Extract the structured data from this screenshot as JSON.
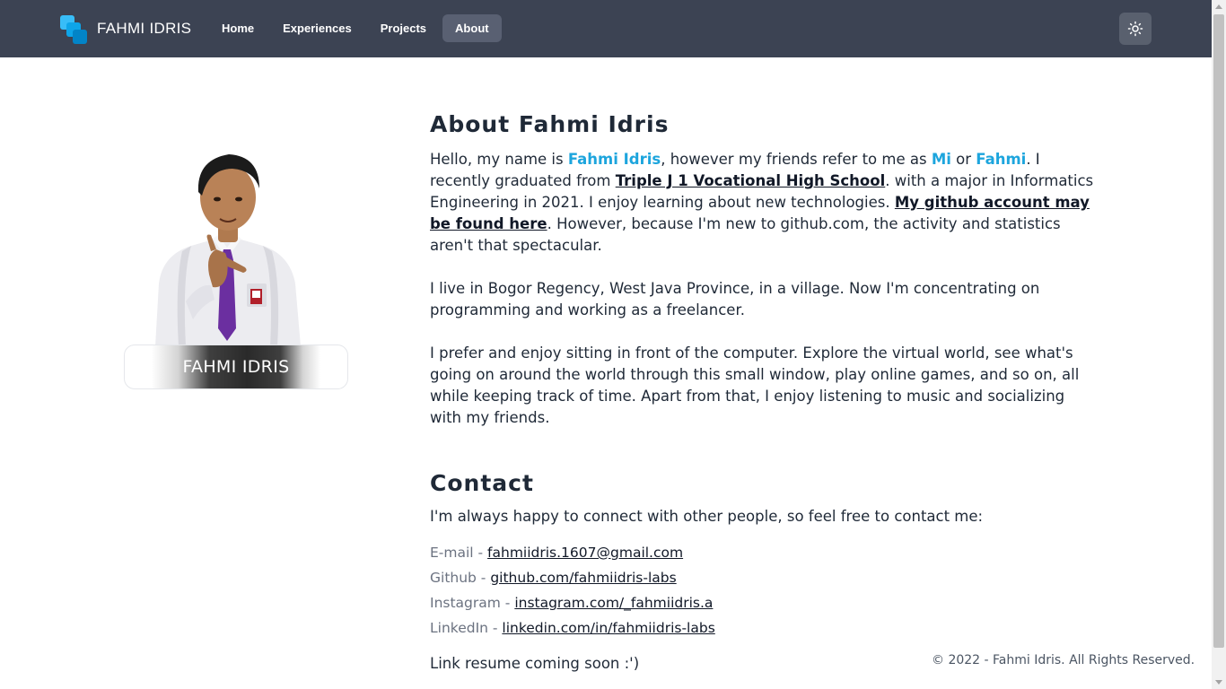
{
  "brand": {
    "name": "FAHMI IDRIS",
    "logo_icon": "stacked-squares-logo-icon"
  },
  "nav": {
    "items": [
      {
        "label": "Home"
      },
      {
        "label": "Experiences"
      },
      {
        "label": "Projects"
      },
      {
        "label": "About"
      }
    ],
    "active": "About"
  },
  "theme_toggle": {
    "icon": "sun-icon"
  },
  "profile": {
    "name_card": "FAHMI IDRIS"
  },
  "about": {
    "title": "About Fahmi Idris",
    "p1": {
      "t1": "Hello, my name is ",
      "name": "Fahmi Idris",
      "t2": ", however my friends refer to me as ",
      "nick1": "Mi",
      "t3": " or ",
      "nick2": "Fahmi",
      "t4": ". I recently graduated from ",
      "school": "Triple J 1 Vocational High School",
      "t5": ". with a major in Informatics Engineering in 2021. I enjoy learning about new technologies. ",
      "github_link": "My github account may be found here",
      "t6": ". However, because I'm new to github.com, the activity and statistics aren't that spectacular."
    },
    "p2": "I live in Bogor Regency, West Java Province, in a village. Now I'm concentrating on programming and working as a freelancer.",
    "p3": "I prefer and enjoy sitting in front of the computer. Explore the virtual world, see what's going on around the world through this small window, play online games, and so on, all while keeping track of time. Apart from that, I enjoy listening to music and socializing with my friends."
  },
  "contact": {
    "title": "Contact",
    "intro": "I'm always happy to connect with other people, so feel free to contact me:",
    "items": [
      {
        "label": "E-mail - ",
        "value": "fahmiidris.1607@gmail.com"
      },
      {
        "label": "Github - ",
        "value": "github.com/fahmiidris-labs"
      },
      {
        "label": "Instagram - ",
        "value": "instagram.com/_fahmiidris.a"
      },
      {
        "label": "LinkedIn - ",
        "value": "linkedin.com/in/fahmiidris-labs"
      }
    ],
    "resume_note": "Link resume coming soon :')"
  },
  "footer": {
    "text": "© 2022 - Fahmi Idris. All Rights Reserved."
  },
  "colors": {
    "navbar": "#3c4353",
    "accent": "#1da5dd",
    "active_nav": "#596072"
  }
}
